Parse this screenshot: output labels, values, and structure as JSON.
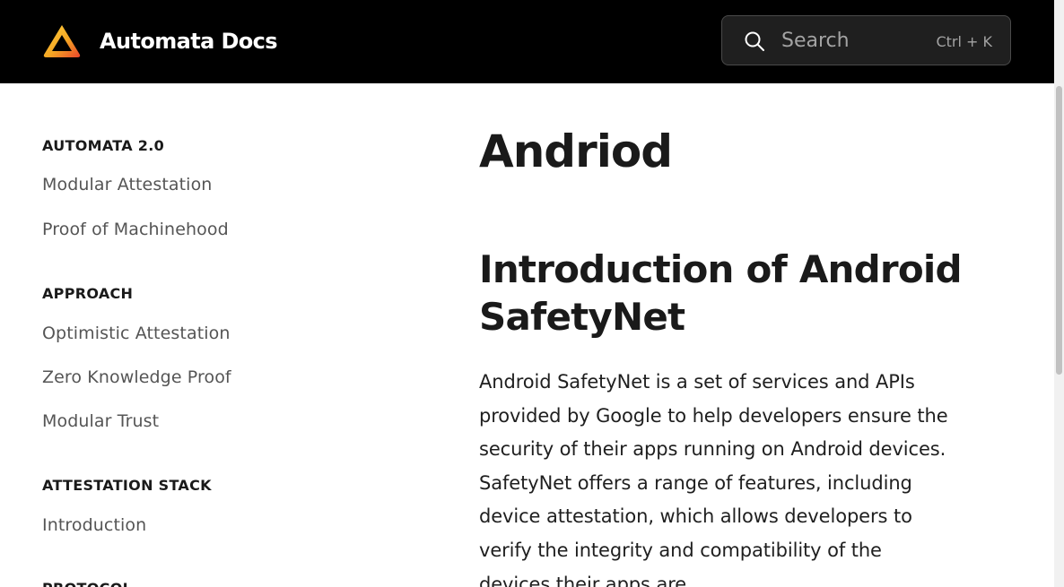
{
  "header": {
    "brand": "Automata Docs",
    "logo_icon": "automata-triangle-logo",
    "search": {
      "placeholder": "Search",
      "shortcut": "Ctrl + K",
      "icon": "search-icon"
    }
  },
  "sidebar": {
    "sections": [
      {
        "heading": "AUTOMATA 2.0",
        "items": [
          "Modular Attestation",
          "Proof of Machinehood"
        ]
      },
      {
        "heading": "APPROACH",
        "items": [
          "Optimistic Attestation",
          "Zero Knowledge Proof",
          "Modular Trust"
        ]
      },
      {
        "heading": "ATTESTATION STACK",
        "items": [
          "Introduction"
        ]
      },
      {
        "heading": "PROTOCOL",
        "items": []
      }
    ]
  },
  "main": {
    "title": "Andriod",
    "section_title": "Introduction of Android SafetyNet",
    "paragraph": "Android SafetyNet is a set of services and APIs provided by Google to help developers ensure the security of their apps running on Android devices. SafetyNet offers a range of features, including device attestation, which allows developers to verify the integrity and compatibility of the devices their apps are"
  },
  "colors": {
    "header_bg": "#000000",
    "logo_gradient": [
      "#f5a623",
      "#e8452c"
    ],
    "text_primary": "#1a1a1a",
    "nav_text": "#555555"
  }
}
